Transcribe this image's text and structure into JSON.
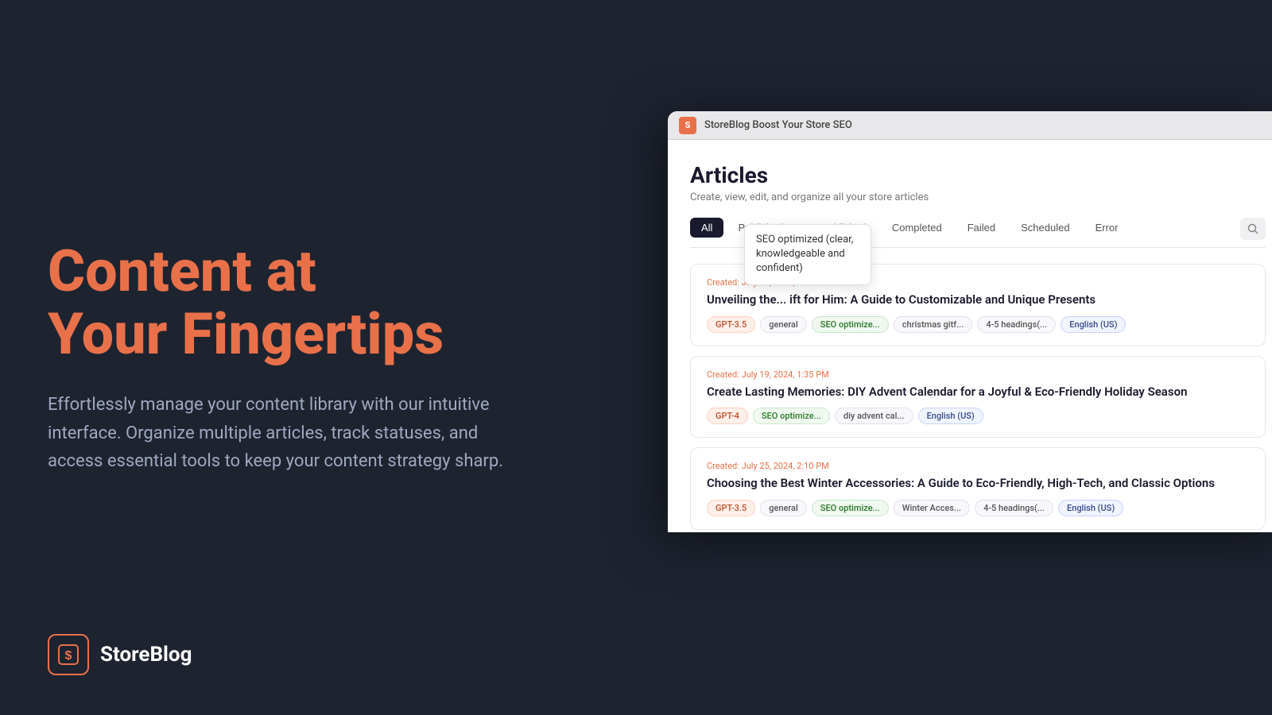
{
  "background": {
    "color": "#1e2330"
  },
  "hero": {
    "title": "Content at\nYour Fingertips",
    "description": "Effortlessly manage your content library with our intuitive interface. Organize multiple articles, track statuses, and access essential tools to keep your content strategy sharp."
  },
  "logo": {
    "icon_text": "$",
    "name": "StoreBlog"
  },
  "browser": {
    "title": "StoreBlog Boost Your Store SEO",
    "app_name": "S"
  },
  "articles_page": {
    "title": "Articles",
    "subtitle": "Create, view, edit, and organize all your store articles",
    "tabs": [
      {
        "label": "All",
        "active": true
      },
      {
        "label": "Published",
        "active": false
      },
      {
        "label": "Unpublished",
        "active": false
      },
      {
        "label": "Completed",
        "active": false
      },
      {
        "label": "Failed",
        "active": false
      },
      {
        "label": "Scheduled",
        "active": false
      },
      {
        "label": "Error",
        "active": false
      }
    ]
  },
  "tooltip": {
    "text": "SEO optimized (clear, knowledgeable and confident)"
  },
  "articles": [
    {
      "date": "Created: July 27, 2024, 4...",
      "title": "Unveiling the... ift for Him: A Guide to Customizable and Unique Presents",
      "tags": [
        {
          "label": "GPT-3.5",
          "type": "model"
        },
        {
          "label": "general",
          "type": "default"
        },
        {
          "label": "SEO optimize...",
          "type": "seo"
        },
        {
          "label": "christmas gitf...",
          "type": "default"
        },
        {
          "label": "4-5 headings(...",
          "type": "default"
        },
        {
          "label": "English (US)",
          "type": "lang"
        }
      ]
    },
    {
      "date": "Created: July 19, 2024, 1:35 PM",
      "title": "Create Lasting Memories: DIY Advent Calendar for a Joyful & Eco-Friendly Holiday Season",
      "tags": [
        {
          "label": "GPT-4",
          "type": "model"
        },
        {
          "label": "SEO optimize...",
          "type": "seo"
        },
        {
          "label": "diy advent cal...",
          "type": "default"
        },
        {
          "label": "English (US)",
          "type": "lang"
        }
      ]
    },
    {
      "date": "Created: July 25, 2024, 2:10 PM",
      "title": "Choosing the Best Winter Accessories: A Guide to Eco-Friendly, High-Tech, and Classic Options",
      "tags": [
        {
          "label": "GPT-3.5",
          "type": "model"
        },
        {
          "label": "general",
          "type": "default"
        },
        {
          "label": "SEO optimize...",
          "type": "seo"
        },
        {
          "label": "Winter Acces...",
          "type": "default"
        },
        {
          "label": "4-5 headings(...",
          "type": "default"
        },
        {
          "label": "English (US)",
          "type": "lang"
        }
      ]
    }
  ]
}
